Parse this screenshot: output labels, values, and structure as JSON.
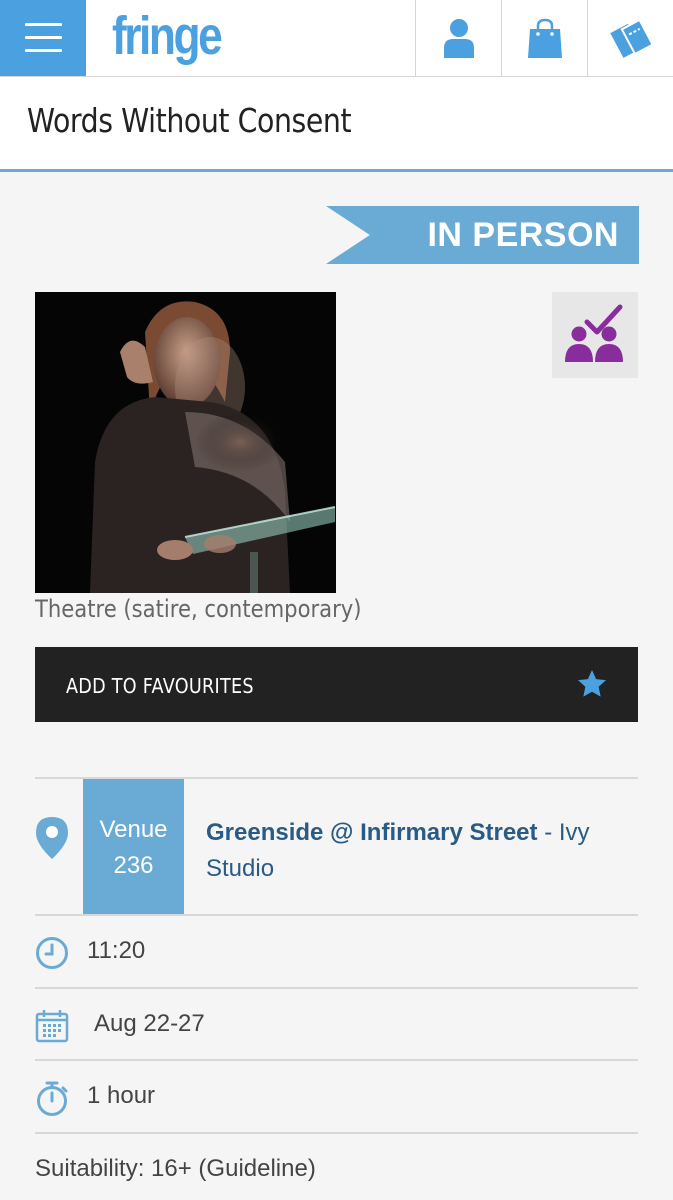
{
  "header": {
    "logo": "fringe",
    "icons": [
      "menu-icon",
      "user-icon",
      "basket-icon",
      "tickets-icon"
    ]
  },
  "show": {
    "title": "Words Without Consent",
    "mode": "IN PERSON",
    "genre": "Theatre (satire, contemporary)",
    "accessibility_icon": "audience-check-icon"
  },
  "favourites": {
    "label": "ADD TO FAVOURITES"
  },
  "venue": {
    "word": "Venue",
    "number": "236",
    "name": "Greenside @ Infirmary Street",
    "separator": " - ",
    "space": "Ivy Studio"
  },
  "details": {
    "time": "11:20",
    "dates": "Aug 22-27",
    "duration": "1 hour",
    "suitability": "Suitability: 16+ (Guideline)"
  },
  "colors": {
    "brand_blue": "#4ba0e0",
    "accent_blue": "#6aabd6",
    "venue_text": "#2a5a86",
    "access_purple": "#8a2d9c",
    "dark_button": "#222222"
  }
}
